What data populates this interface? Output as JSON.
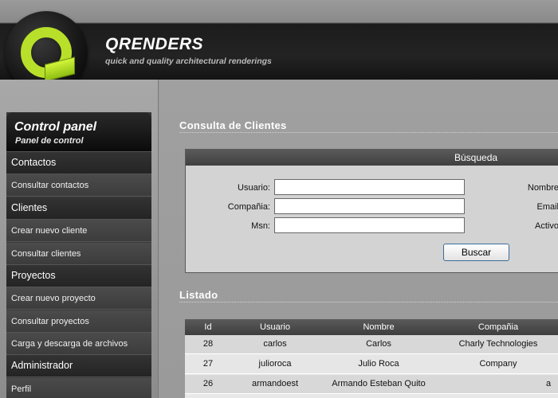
{
  "brand": {
    "title": "QRENDERS",
    "subtitle": "quick and quality architectural renderings",
    "accent_color": "#b8e02a"
  },
  "sidebar": {
    "title": "Control panel",
    "subtitle": "Panel de control",
    "items": [
      {
        "label": "Contactos",
        "kind": "section"
      },
      {
        "label": "Consultar contactos",
        "kind": "link"
      },
      {
        "label": "Clientes",
        "kind": "section"
      },
      {
        "label": "Crear nuevo cliente",
        "kind": "link"
      },
      {
        "label": "Consultar clientes",
        "kind": "link"
      },
      {
        "label": "Proyectos",
        "kind": "section"
      },
      {
        "label": "Crear nuevo proyecto",
        "kind": "link"
      },
      {
        "label": "Consultar proyectos",
        "kind": "link"
      },
      {
        "label": "Carga y descarga de archivos",
        "kind": "link"
      },
      {
        "label": "Administrador",
        "kind": "section"
      },
      {
        "label": "Perfil",
        "kind": "link"
      }
    ]
  },
  "main": {
    "page_title": "Consulta de Clientes",
    "search": {
      "header": "Búsqueda",
      "labels": {
        "usuario": "Usuario:",
        "compania": "Compañia:",
        "msn": "Msn:",
        "nombre": "Nombre",
        "email": "Email",
        "activo": "Activo"
      },
      "values": {
        "usuario": "",
        "compania": "",
        "msn": ""
      },
      "button": "Buscar"
    },
    "listing": {
      "title": "Listado",
      "columns": [
        "Id",
        "Usuario",
        "Nombre",
        "Compañia"
      ],
      "rows": [
        [
          "28",
          "carlos",
          "Carlos",
          "Charly Technologies"
        ],
        [
          "27",
          "julioroca",
          "Julio Roca",
          "Company"
        ],
        [
          "26",
          "armandoest",
          "Armando Esteban Quito",
          "a"
        ]
      ]
    }
  }
}
